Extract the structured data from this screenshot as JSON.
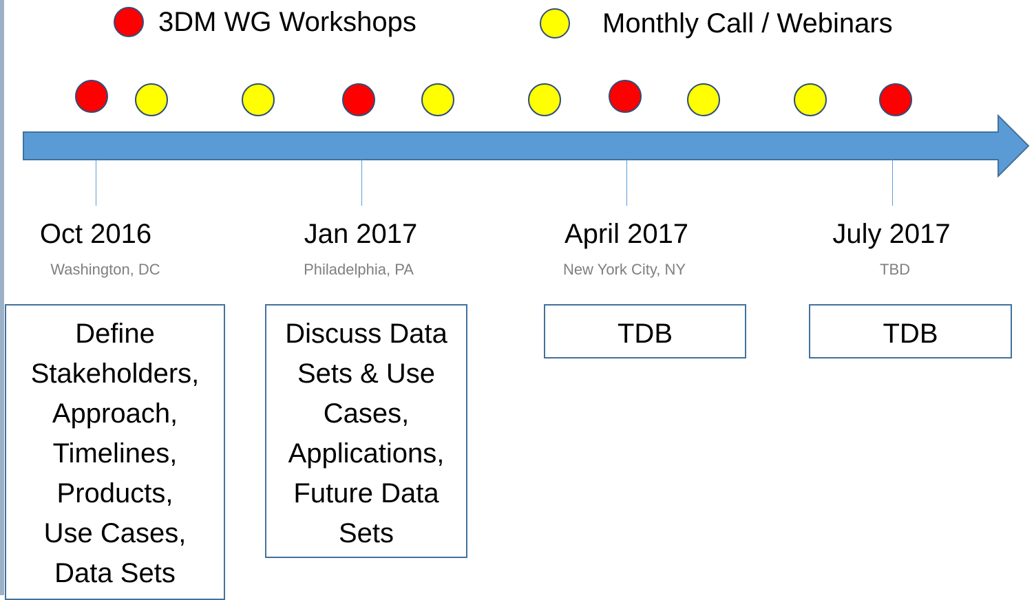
{
  "legend": {
    "workshops_label": "3DM WG Workshops",
    "calls_label": "Monthly Call / Webinars",
    "workshops_color": "#ff0000",
    "calls_color": "#ffff00"
  },
  "timeline": {
    "arrow_color": "#5b9bd5",
    "events": [
      {
        "type": "workshop"
      },
      {
        "type": "call"
      },
      {
        "type": "call"
      },
      {
        "type": "workshop"
      },
      {
        "type": "call"
      },
      {
        "type": "call"
      },
      {
        "type": "workshop"
      },
      {
        "type": "call"
      },
      {
        "type": "call"
      },
      {
        "type": "workshop"
      }
    ],
    "milestones": [
      {
        "date": "Oct 2016",
        "location": "Washington, DC",
        "description": "Define\nStakeholders,\nApproach,\nTimelines,\nProducts,\nUse Cases,\nData Sets"
      },
      {
        "date": "Jan 2017",
        "location": "Philadelphia, PA",
        "description": "Discuss Data\nSets & Use\nCases,\nApplications,\nFuture Data\nSets"
      },
      {
        "date": "April 2017",
        "location": "New York City, NY",
        "description": "TDB"
      },
      {
        "date": "July 2017",
        "location": "TBD",
        "description": "TDB"
      }
    ]
  }
}
